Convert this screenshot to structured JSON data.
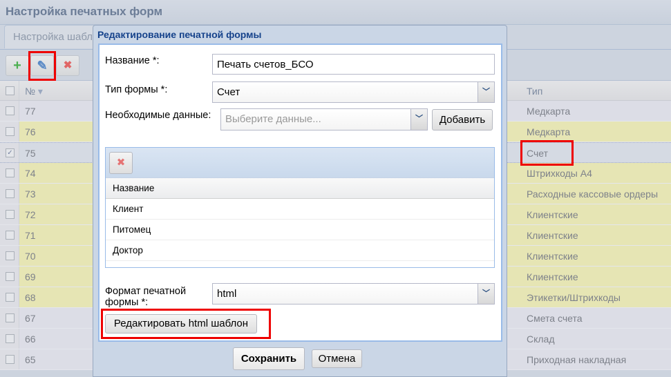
{
  "app": {
    "title": "Настройка печатных форм",
    "tab": "Настройка шаблонов"
  },
  "toolbar": {
    "add": "+",
    "edit": "✎",
    "delete": "✖"
  },
  "grid": {
    "col_num": "№",
    "col_sort": "▾",
    "col_type": "Тип",
    "rows": [
      {
        "num": "77",
        "type": "Медкарта",
        "style": "gray",
        "checked": false
      },
      {
        "num": "76",
        "type": "Медкарта",
        "style": "yellow",
        "checked": false
      },
      {
        "num": "75",
        "type": "Счет",
        "style": "selected",
        "checked": true
      },
      {
        "num": "74",
        "type": "Штрихкоды А4",
        "style": "yellow",
        "checked": false
      },
      {
        "num": "73",
        "type": "Расходные кассовые ордеры",
        "style": "yellow",
        "checked": false
      },
      {
        "num": "72",
        "type": "Клиентские",
        "style": "yellow",
        "checked": false
      },
      {
        "num": "71",
        "type": "Клиентские",
        "style": "yellow",
        "checked": false
      },
      {
        "num": "70",
        "type": "Клиентские",
        "style": "yellow",
        "checked": false
      },
      {
        "num": "69",
        "type": "Клиентские",
        "style": "yellow",
        "checked": false
      },
      {
        "num": "68",
        "type": "Этикетки/Штрихкоды",
        "style": "yellow",
        "checked": false
      },
      {
        "num": "67",
        "type": "Смета счета",
        "style": "gray",
        "checked": false
      },
      {
        "num": "66",
        "type": "Склад",
        "style": "gray",
        "checked": false
      },
      {
        "num": "65",
        "type": "Приходная накладная",
        "style": "gray",
        "checked": false
      }
    ]
  },
  "dialog": {
    "title": "Редактирование печатной формы",
    "name_label": "Название *:",
    "name_value": "Печать счетов_БСО",
    "type_label": "Тип формы *:",
    "type_value": "Счет",
    "data_label": "Необходимые данные:",
    "data_placeholder": "Выберите данные...",
    "add_button": "Добавить",
    "data_grid": {
      "header": "Название",
      "rows": [
        "Клиент",
        "Питомец",
        "Доктор"
      ]
    },
    "format_label": "Формат печатной формы *:",
    "format_value": "html",
    "edit_template_button": "Редактировать html шаблон",
    "save_button": "Сохранить",
    "cancel_button": "Отмена"
  },
  "colors": {
    "yellow": "#e6e5b4",
    "gray": "#dcdde6",
    "selected": "#d5dae3",
    "highlight": "#ee0000"
  }
}
